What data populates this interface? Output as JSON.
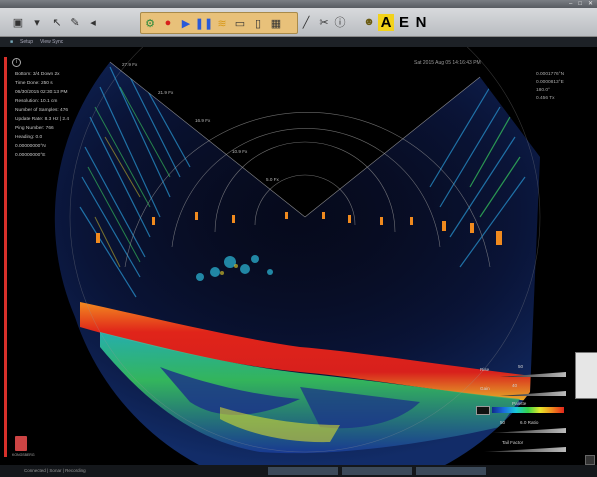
{
  "info": {
    "lines": [
      "Bottom: 3/4 Down 2x",
      "Time Done: 250 s",
      "06/30/2015 02:30:13 PM",
      "Resolution: 10.1 cm",
      "Number of Samples: 476",
      "Update Rate: 8.3 Hz | 2.4",
      "Ping Number: 766",
      "Heading: 0.0",
      "0.00000000°N",
      "0.00000000°E"
    ]
  },
  "timestamp": "Sat 2015 Aug 05 14:16:43 PM",
  "right_info": [
    "0.0001776°N",
    "0.0000813°E",
    "180.0°",
    "0.456 Tx"
  ],
  "range_labels": [
    "27.9 Fx",
    "21.9 Fx",
    "16.9 Fx",
    "10.9 Fx",
    "5.0 Fx"
  ],
  "menu": [
    "Setup",
    "View Sync"
  ],
  "toolbar_letters": [
    "A",
    "E",
    "N"
  ],
  "controls": {
    "rows": [
      {
        "label": "Rise",
        "value": "50"
      },
      {
        "label": "Gain",
        "value": "40"
      },
      {
        "label": "Palette",
        "value": ""
      },
      {
        "label": "50",
        "value": "6.0 Ratio"
      },
      {
        "label": "Tail Factor",
        "value": ""
      }
    ]
  },
  "brand": "KONGSBERG",
  "status_text": "Connected | Sonar | Recording",
  "colors": {
    "accent_red": "#d8302a",
    "toolbar_group": "#e8c17a",
    "highlight_yellow": "#f2d21a"
  }
}
